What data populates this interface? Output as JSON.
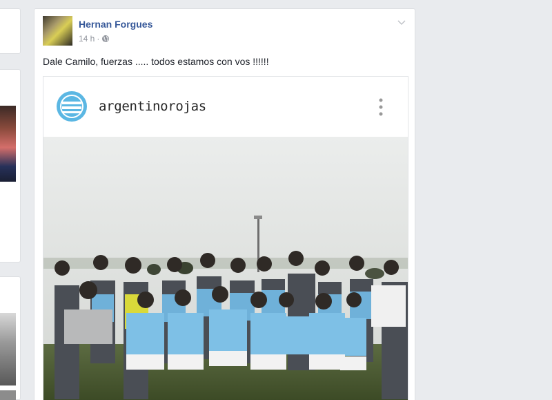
{
  "post": {
    "author": "Hernan Forgues",
    "timestamp": "14 h",
    "privacy_icon": "globe-icon",
    "text": "Dale Camilo, fuerzas ..... todos estamos con vos !!!!!!"
  },
  "embed": {
    "username": "argentinorojas"
  },
  "colors": {
    "background": "#e9ebee",
    "author_link": "#365899",
    "meta_text": "#90949c",
    "badge_blue": "#5bb7e3"
  }
}
